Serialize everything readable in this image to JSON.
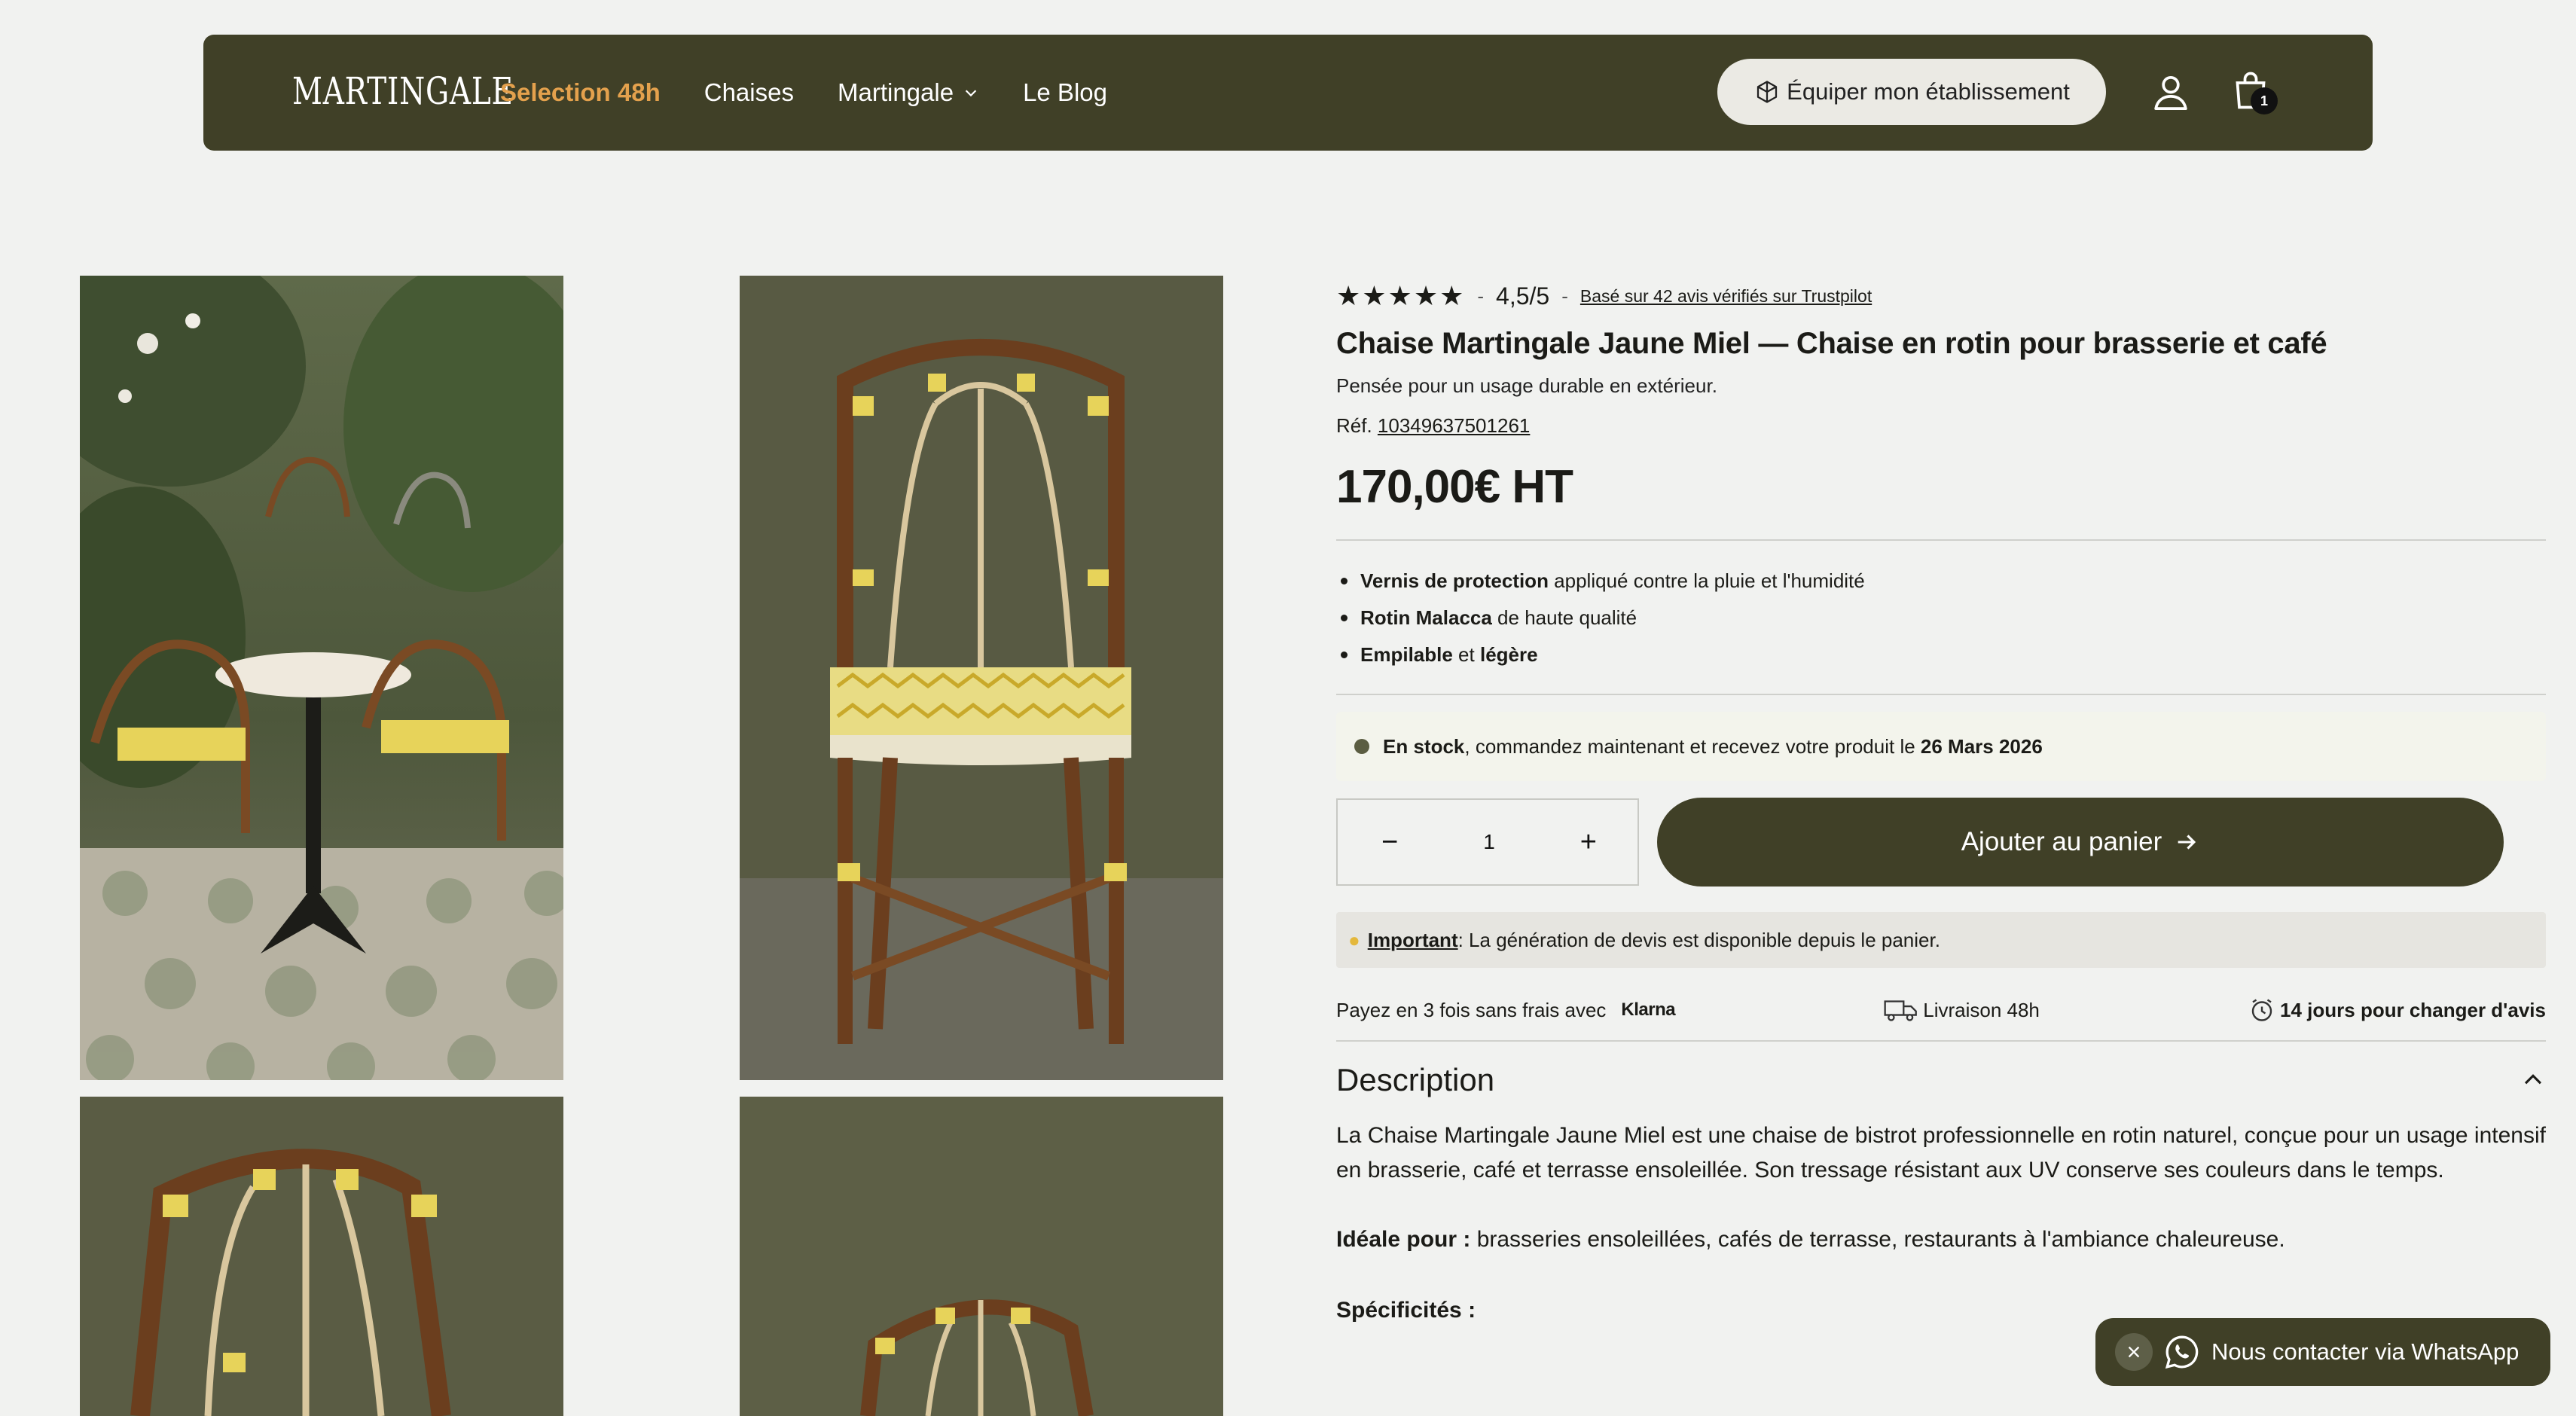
{
  "header": {
    "logo": "MARTINGALE",
    "nav": [
      "Selection 48h",
      "Chaises",
      "Martingale",
      "Le Blog"
    ],
    "cta_label": "Équiper mon établissement",
    "cart_count": "1"
  },
  "product": {
    "stars": "★★★★★",
    "rating_sep": "-",
    "rating": "4,5/5",
    "reviews_link": "Basé sur 42 avis vérifiés sur Trustpilot",
    "title": "Chaise Martingale Jaune Miel — Chaise en rotin pour brasserie et café",
    "subtitle": "Pensée pour un usage durable en extérieur.",
    "ref_label": "Réf.",
    "ref_number": "10349637501261",
    "price": "170,00€ HT",
    "features": [
      {
        "bold": "Vernis de protection",
        "rest": " appliqué contre la pluie et l'humidité"
      },
      {
        "bold": "Rotin Malacca",
        "rest": " de haute qualité"
      },
      {
        "bold": "Empilable",
        "mid": " et ",
        "bold2": "légère"
      }
    ],
    "stock": {
      "bold": "En stock",
      "text": ", commandez maintenant et recevez votre produit le ",
      "date": "26 Mars 2026"
    },
    "quantity": "1",
    "qty_minus": "−",
    "qty_plus": "+",
    "add_to_cart": "Ajouter au panier",
    "important_label": "Important",
    "important_text": " : La génération de devis est disponible depuis le panier.",
    "perks": {
      "pay": "Payez en 3 fois sans frais avec",
      "klarna": "Klarna",
      "delivery": "Livraison 48h",
      "returns": "14 jours pour changer d'avis"
    },
    "description_title": "Description",
    "description_text": "La Chaise Martingale Jaune Miel est une chaise de bistrot professionnelle en rotin naturel, conçue pour un usage intensif en brasserie, café et terrasse ensoleillée. Son tressage résistant aux UV conserve ses couleurs dans le temps.",
    "ideal_label": "Idéale pour :",
    "ideal_text": " brasseries ensoleillées, cafés de terrasse, restaurants à l'ambiance chaleureuse.",
    "specs_label": "Spécificités :"
  },
  "whatsapp": {
    "label": "Nous contacter via WhatsApp"
  },
  "colors": {
    "brand": "#404027",
    "accent": "#e4a14d",
    "background": "#f1f2f0"
  }
}
